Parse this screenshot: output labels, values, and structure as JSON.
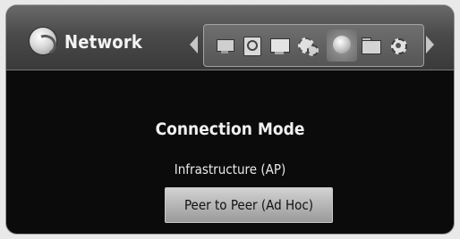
{
  "header": {
    "title": "Network",
    "logo_icon": "network-globe-icon"
  },
  "menu": {
    "items": [
      {
        "icon": "tv-icon"
      },
      {
        "icon": "disc-icon"
      },
      {
        "icon": "display-icon"
      },
      {
        "icon": "gears-icon"
      },
      {
        "icon": "network-globe-icon",
        "selected": true
      },
      {
        "icon": "folder-icon"
      },
      {
        "icon": "settings-cog-icon"
      }
    ]
  },
  "main": {
    "heading": "Connection Mode",
    "options": [
      "Infrastructure (AP)",
      "Peer to Peer (Ad Hoc)"
    ],
    "selected_option": "Peer to Peer (Ad Hoc)"
  },
  "colors": {
    "background": "#0b0b0b",
    "header": "#4a4a4a",
    "highlight": "#bdbdbd"
  }
}
